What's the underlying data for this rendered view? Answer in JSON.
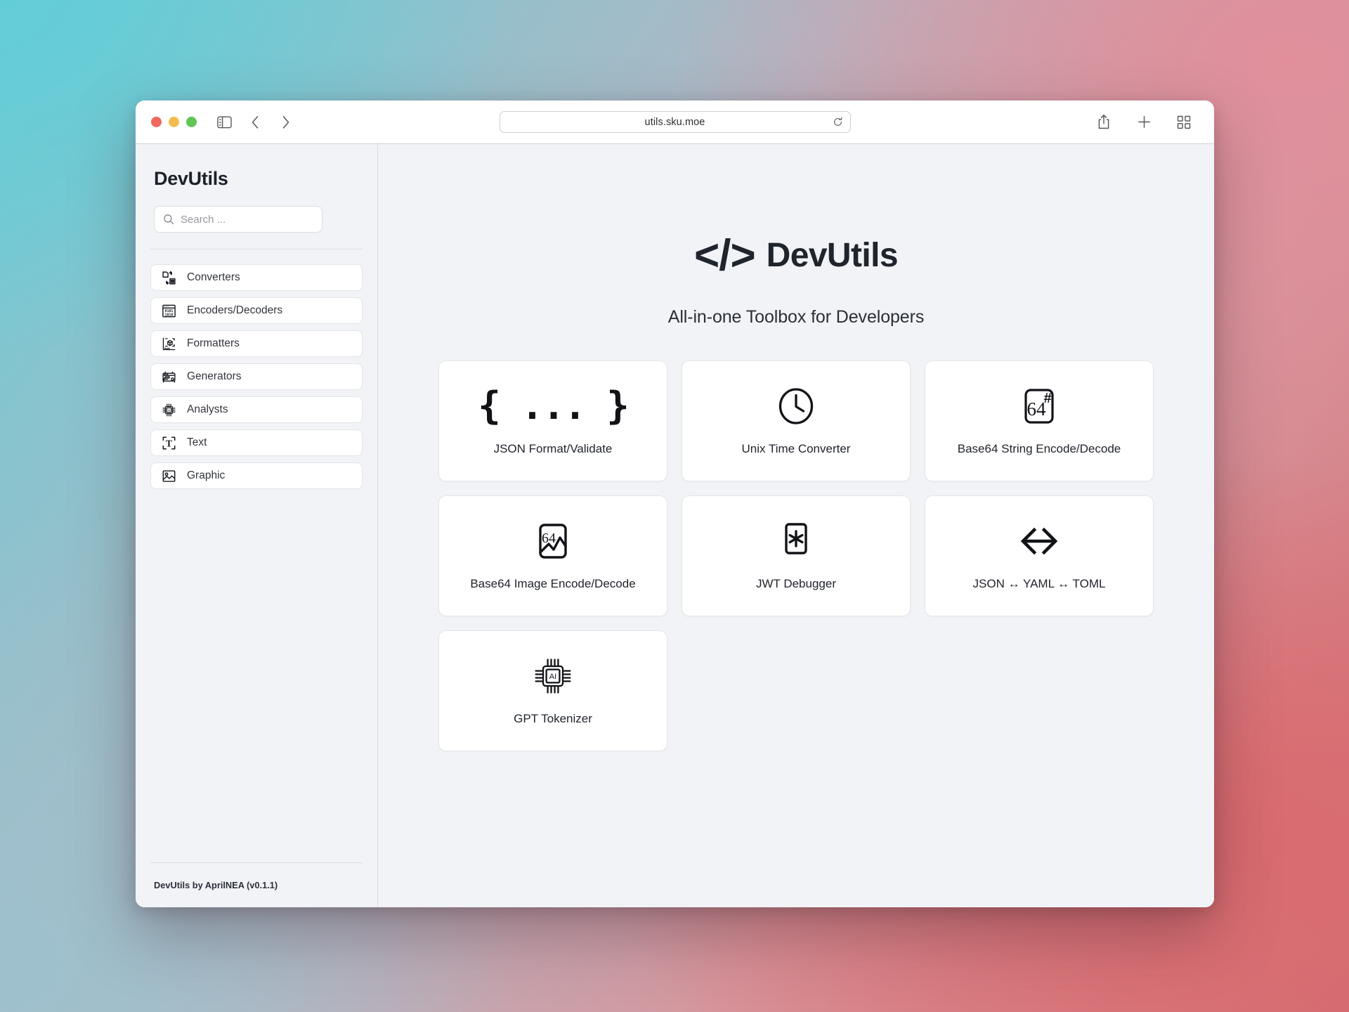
{
  "browser": {
    "url": "utils.sku.moe",
    "reload_icon": "reload-icon",
    "sidebar_toggle_icon": "sidebar-toggle-icon",
    "back_icon": "chevron-left-icon",
    "forward_icon": "chevron-right-icon",
    "share_icon": "share-icon",
    "new_tab_icon": "plus-icon",
    "tab_overview_icon": "tab-overview-icon",
    "traffic_lights": [
      "close",
      "minimize",
      "zoom"
    ]
  },
  "sidebar": {
    "brand": "DevUtils",
    "search": {
      "placeholder": "Search ...",
      "value": "",
      "icon": "search-icon"
    },
    "items": [
      {
        "label": "Converters",
        "icon": "converters-icon"
      },
      {
        "label": "Encoders/Decoders",
        "icon": "binary-icon"
      },
      {
        "label": "Formatters",
        "icon": "formatters-icon"
      },
      {
        "label": "Generators",
        "icon": "generator-icon"
      },
      {
        "label": "Analysts",
        "icon": "chip-ai-icon"
      },
      {
        "label": "Text",
        "icon": "text-select-icon"
      },
      {
        "label": "Graphic",
        "icon": "image-icon"
      }
    ],
    "footer": "DevUtils by AprilNEA (v0.1.1)"
  },
  "main": {
    "logo_mark": "</>",
    "logo_name": "DevUtils",
    "tagline": "All-in-one Toolbox for Developers",
    "tools": [
      {
        "label": "JSON Format/Validate",
        "icon": "json-braces-icon"
      },
      {
        "label": "Unix Time Converter",
        "icon": "clock-icon"
      },
      {
        "label": "Base64 String Encode/Decode",
        "icon": "base64-string-icon"
      },
      {
        "label": "Base64 Image Encode/Decode",
        "icon": "base64-image-icon"
      },
      {
        "label": "JWT Debugger",
        "icon": "jwt-asterisk-icon"
      },
      {
        "label": "JSON ↔ YAML ↔ TOML",
        "icon": "bidirectional-arrow-icon"
      },
      {
        "label": "GPT Tokenizer",
        "icon": "chip-ai-icon"
      }
    ]
  },
  "colors": {
    "page_bg_start": "#63cdd7",
    "page_bg_end": "#d4666c",
    "window_bg": "#ffffff",
    "surface": "#f1f3f7",
    "card": "#ffffff",
    "text": "#1f232a",
    "muted": "#95979e"
  }
}
